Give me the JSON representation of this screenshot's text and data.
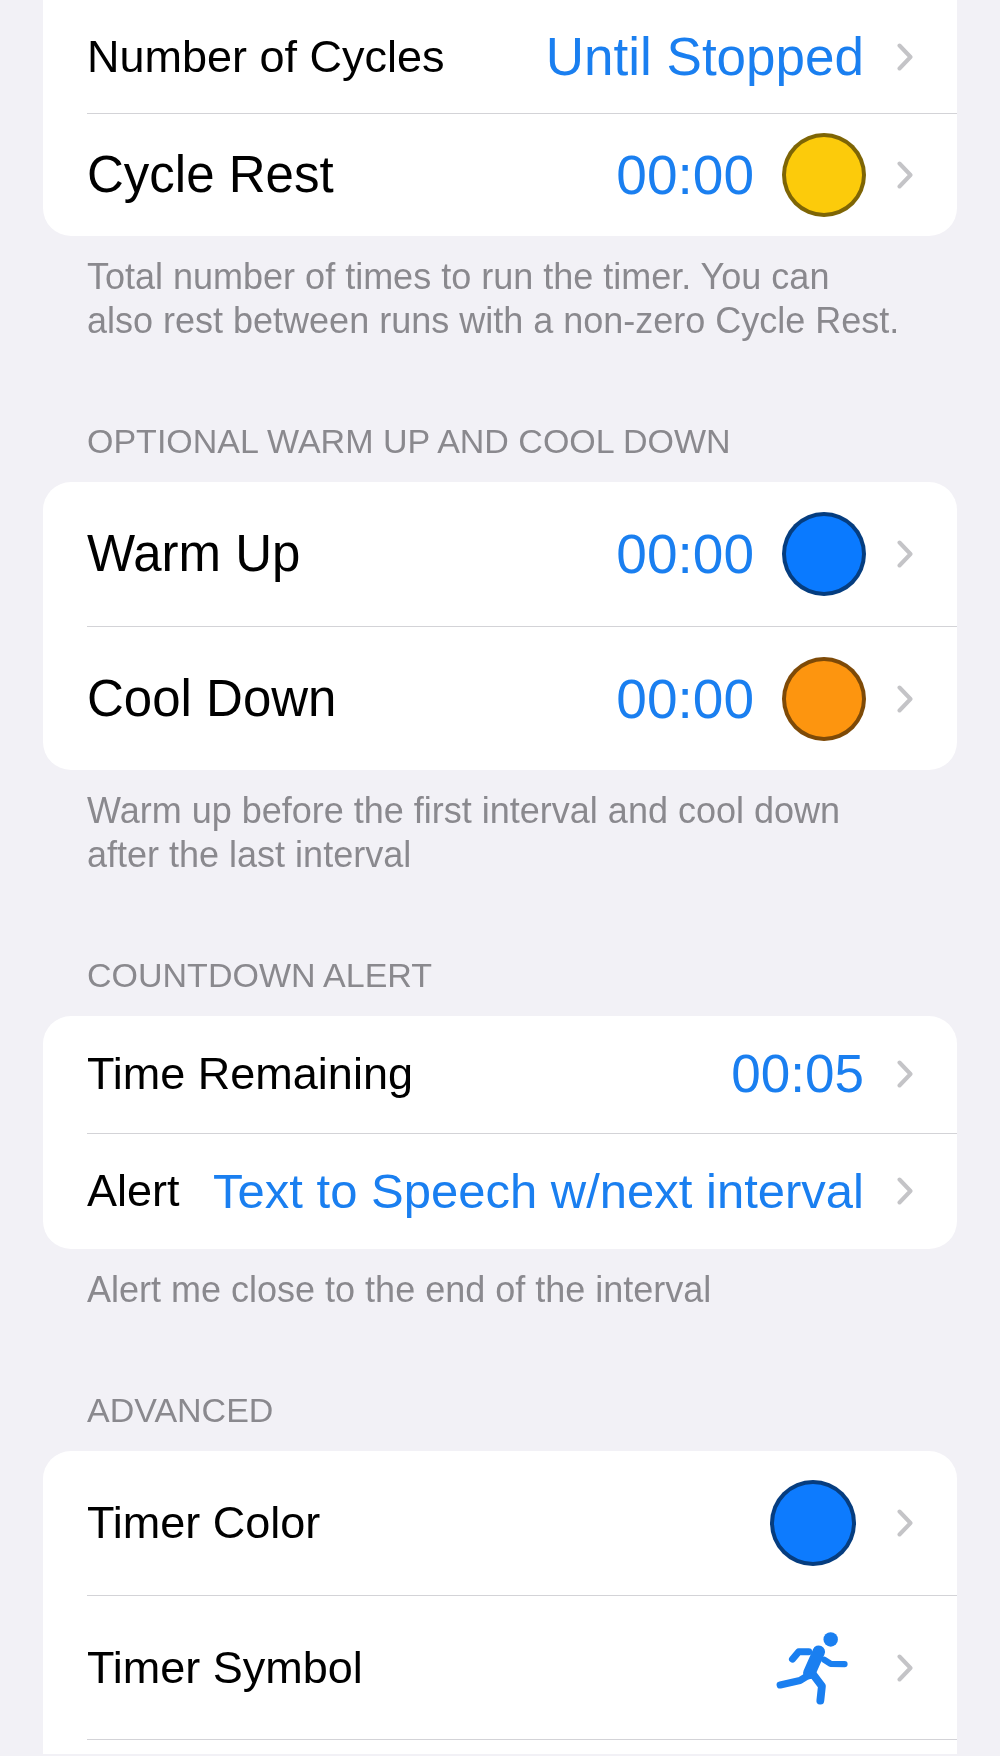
{
  "sections": [
    {
      "rows": [
        {
          "kind": "value",
          "label": "Number of Cycles",
          "value": "Until Stopped"
        },
        {
          "kind": "value_color",
          "label": "Cycle Rest",
          "value": "00:00",
          "color": "#fccb0b"
        }
      ],
      "footer": "Total number of times to run the timer. You can\nalso rest between runs with a non-zero Cycle Rest."
    },
    {
      "header": "OPTIONAL WARM UP AND COOL DOWN",
      "rows": [
        {
          "kind": "value_color",
          "label": "Warm Up",
          "value": "00:00",
          "color": "#0a7aff"
        },
        {
          "kind": "value_color",
          "label": "Cool Down",
          "value": "00:00",
          "color": "#fd950f"
        }
      ],
      "footer": "Warm up before the first interval and cool down\nafter the last interval"
    },
    {
      "header": "COUNTDOWN ALERT",
      "rows": [
        {
          "kind": "value",
          "label": "Time Remaining",
          "value": "00:05"
        },
        {
          "kind": "compact_value",
          "label": "Alert",
          "value": "Text to Speech w/next interval"
        }
      ],
      "footer": "Alert me close to the end of the interval"
    },
    {
      "header": "ADVANCED",
      "rows": [
        {
          "kind": "color",
          "label": "Timer Color",
          "color": "#0d7bfe"
        },
        {
          "kind": "symbol",
          "label": "Timer Symbol"
        }
      ],
      "continues_below": true
    }
  ]
}
